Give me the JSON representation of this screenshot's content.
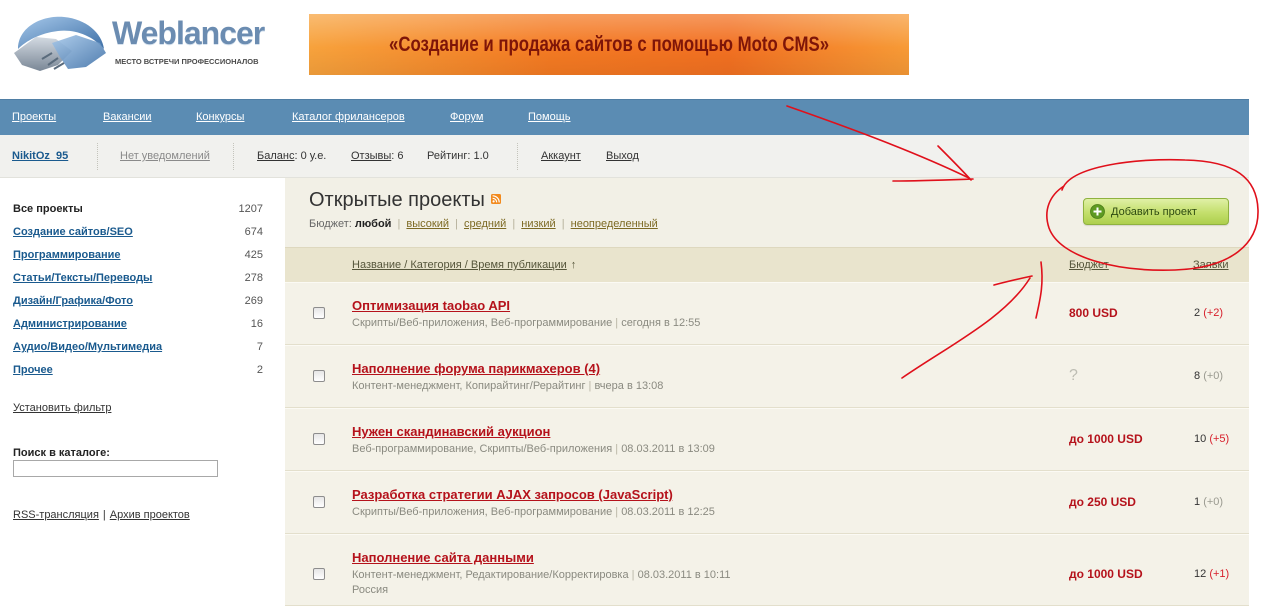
{
  "header": {
    "logo_text": "Weblancer",
    "logo_tagline": "МЕСТО ВСТРЕЧИ ПРОФЕССИОНАЛОВ",
    "banner_text": "«Создание и продажа сайтов с помощью Moto CMS»"
  },
  "nav": {
    "items": [
      "Проекты",
      "Вакансии",
      "Конкурсы",
      "Каталог фрилансеров",
      "Форум",
      "Помощь"
    ]
  },
  "user_bar": {
    "username": "NikitOz_95",
    "notifications": "Нет уведомлений",
    "balance_link": "Баланс",
    "balance_value": ": 0 у.е.",
    "reviews_link": "Отзывы",
    "reviews_value": ": 6",
    "rating": "Рейтинг: 1.0",
    "account": "Аккаунт",
    "logout": "Выход"
  },
  "sidebar": {
    "categories": [
      {
        "label": "Все проекты",
        "count": "1207"
      },
      {
        "label": "Создание сайтов/SEO",
        "count": "674"
      },
      {
        "label": "Программирование",
        "count": "425"
      },
      {
        "label": "Статьи/Тексты/Переводы",
        "count": "278"
      },
      {
        "label": "Дизайн/Графика/Фото",
        "count": "269"
      },
      {
        "label": "Администрирование",
        "count": "16"
      },
      {
        "label": "Аудио/Видео/Мультимедиа",
        "count": "7"
      },
      {
        "label": "Прочее",
        "count": "2"
      }
    ],
    "filter_link": "Установить фильтр",
    "search_label": "Поиск в каталоге:",
    "search_value": "",
    "rss_link": "RSS-трансляция",
    "links_separator": "|",
    "archive_link": "Архив проектов"
  },
  "main": {
    "title": "Открытые проекты",
    "budget_filter": {
      "label": "Бюджет:",
      "selected": "любой",
      "options": [
        "высокий",
        "средний",
        "низкий",
        "неопределенный"
      ],
      "separator": "|"
    },
    "add_project_button": "Добавить проект",
    "table_header": {
      "name_column": "Название / Категория / Время публикации",
      "sort_indicator": "↑",
      "budget_column": "Бюджет",
      "bids_column": "Заявки"
    },
    "meta_separator": "|",
    "projects": [
      {
        "title": "Оптимизация taobao API",
        "categories": "Скрипты/Веб-приложения, Веб-программирование",
        "published": "сегодня в 12:55",
        "budget": "800 USD",
        "bids": "2",
        "bids_new": "(+2)"
      },
      {
        "title": "Наполнение форума парикмахеров (4)",
        "categories": "Контент-менеджмент, Копирайтинг/Рерайтинг",
        "published": "вчера в 13:08",
        "budget": "?",
        "bids": "8",
        "bids_new": "(+0)"
      },
      {
        "title": "Нужен скандинавский аукцион",
        "categories": "Веб-программирование, Скрипты/Веб-приложения",
        "published": "08.03.2011 в 13:09",
        "budget": "до 1000 USD",
        "bids": "10",
        "bids_new": "(+5)"
      },
      {
        "title": "Разработка стратегии AJAX запросов (JavaScript)",
        "categories": "Скрипты/Веб-приложения, Веб-программирование",
        "published": "08.03.2011 в 12:25",
        "budget": "до 250 USD",
        "bids": "1",
        "bids_new": "(+0)"
      },
      {
        "title": "Наполнение сайта данными",
        "categories": "Контент-менеджмент, Редактирование/Корректировка",
        "published": "08.03.2011 в 10:11",
        "location": "Россия",
        "budget": "до 1000 USD",
        "bids": "12",
        "bids_new": "(+1)"
      }
    ]
  },
  "colors": {
    "nav_bar": "#5b8cb3",
    "user_bar": "#f1f1ee",
    "content_bg": "#f2f0e6",
    "table_header_bg": "#e9e4cd",
    "accent_red": "#b5121b",
    "link_blue": "#1a5a8e",
    "button_green": "#aecf4d",
    "banner_orange": "#f47a22",
    "annotation_red": "#e0101b"
  },
  "icons": {
    "logo": "handshake-icon",
    "rss": "rss-icon",
    "add": "plus-circle-icon",
    "row_select": "checkbox-icon"
  }
}
